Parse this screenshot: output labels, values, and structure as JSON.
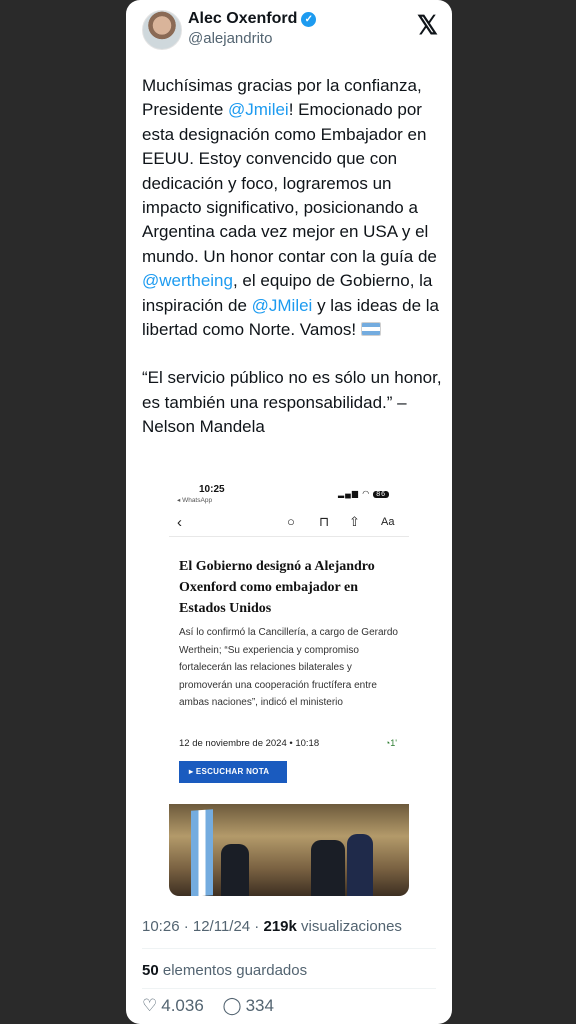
{
  "user": {
    "name": "Alec Oxenford",
    "handle": "@alejandrito"
  },
  "tweet": {
    "seg1": "Muchísimas gracias por la confianza, Presidente ",
    "mention1": "@Jmilei",
    "seg2": "! Emocionado por esta designación como Embajador en EEUU. Estoy convencido que con dedicación y foco, lograremos un impacto significativo, posicionando a Argentina cada vez mejor en USA y el mundo. Un honor contar con la guía de ",
    "mention2": "@wertheing",
    "seg3": ", el equipo de Gobierno, la inspiración de ",
    "mention3": "@JMilei",
    "seg4": " y las ideas de la libertad como Norte. Vamos! ",
    "quote": "“El servicio público no es sólo un honor, es también una responsabilidad.” – Nelson Mandela"
  },
  "media": {
    "status_time": "10:25",
    "status_app": "◂ WhatsApp",
    "battery": "86",
    "title": "El Gobierno designó a Alejandro Oxenford como embajador en Estados Unidos",
    "subtitle": "Así lo confirmó la Cancillería, a cargo de Gerardo Werthein; “Su experiencia y compromiso fortalecerán las relaciones bilaterales y promoverán una cooperación fructífera entre ambas naciones”, indicó el ministerio",
    "date": "12 de noviembre de 2024 • 10:18",
    "read_time": "1'",
    "listen_label": "▸ ESCUCHAR NOTA"
  },
  "footer": {
    "time": "10:26 · 12/11/24 · ",
    "views_count": "219k",
    "views_label": " visualizaciones",
    "saves_count": "50",
    "saves_label": " elementos guardados",
    "likes": "4.036",
    "replies": "334"
  },
  "colors": {
    "link": "#1d9bf0",
    "verified": "#1d9bf0",
    "listen_button": "#1a5bbf"
  }
}
